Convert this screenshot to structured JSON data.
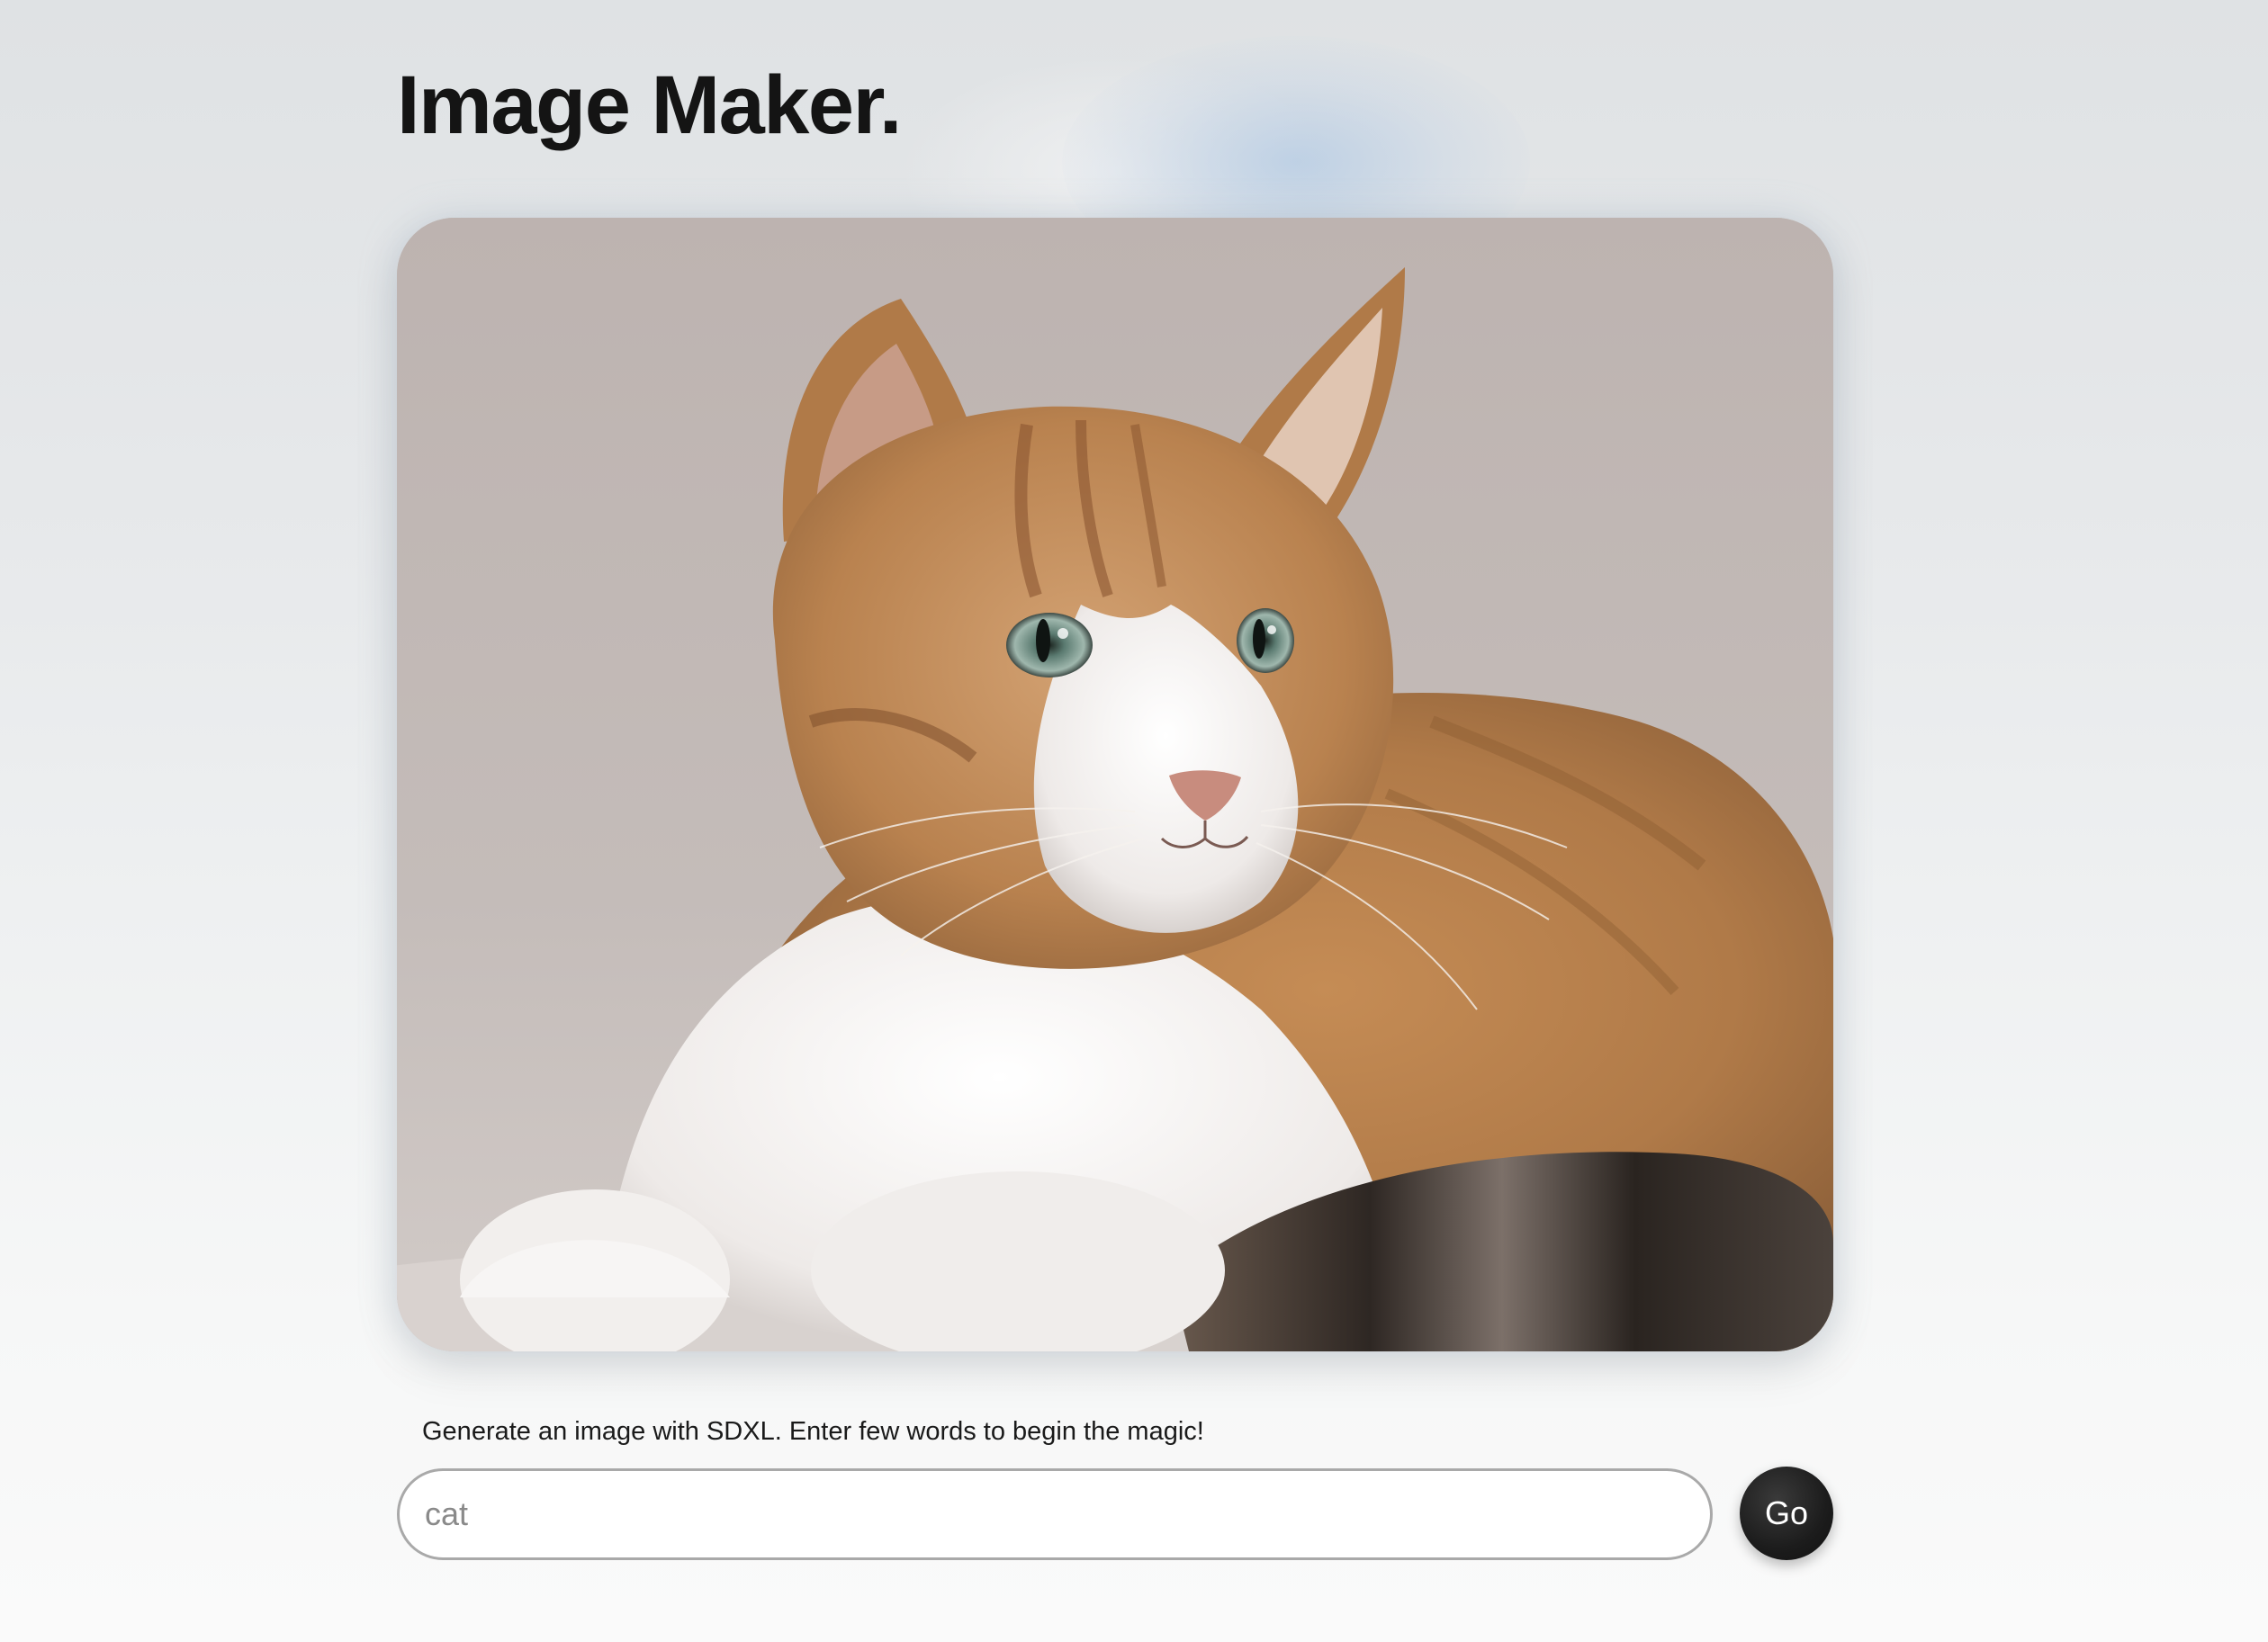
{
  "page": {
    "title": "Image Maker."
  },
  "generated_image": {
    "subject": "cat"
  },
  "prompt": {
    "helper_text": "Generate an image with SDXL. Enter few words to begin the magic!",
    "value": "cat",
    "placeholder": ""
  },
  "actions": {
    "go_label": "Go"
  },
  "colors": {
    "title": "#141414",
    "button_bg": "#1c1c1c",
    "button_text": "#ffffff",
    "input_border": "#a9a9a9",
    "glow_accent": "#b8cde4"
  }
}
